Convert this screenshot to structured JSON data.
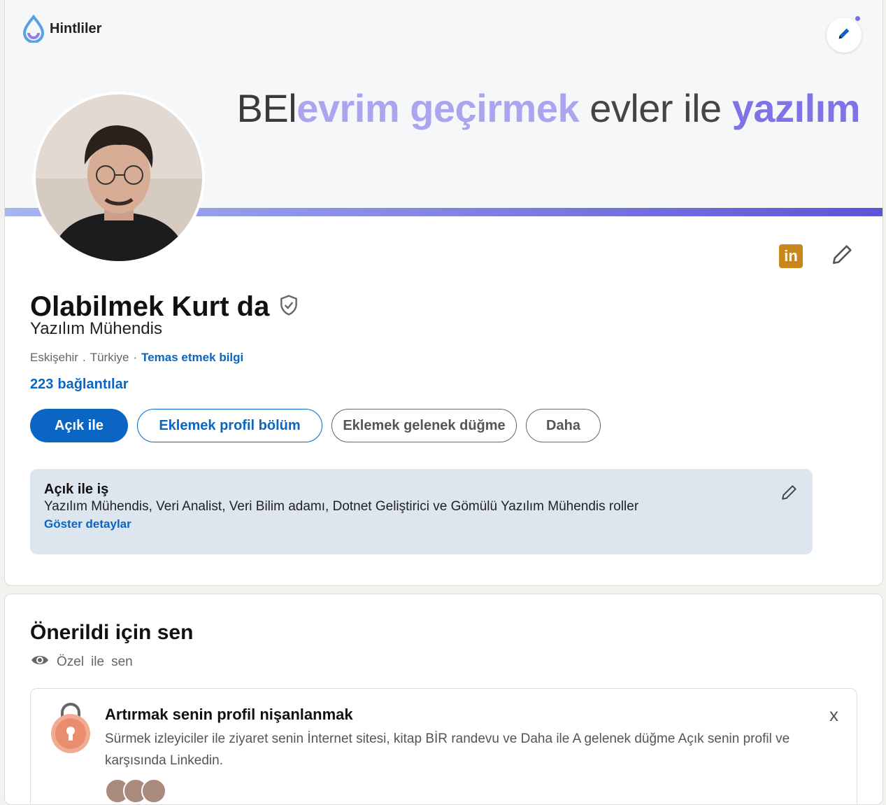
{
  "banner": {
    "brand_name": "Hintliler",
    "tagline": {
      "part1": "BEl",
      "part2": "evrim geçirmek",
      "part3": "evler",
      "part4": "ile",
      "part5": "yazılım"
    }
  },
  "profile": {
    "first_name": "Olabilmek",
    "last_name": "Kurt da",
    "headline": {
      "word1": "Yazılım",
      "word2": "Mühendis"
    },
    "location": {
      "city": "Eskişehir",
      "separator": ".",
      "country": "Türkiye",
      "dot": "·",
      "contact_1": "Temas etmek",
      "contact_2": "bilgi"
    },
    "connections": {
      "count": "223",
      "label": "bağlantılar"
    }
  },
  "actions": {
    "open_to_1": "Açık",
    "open_to_2": "ile",
    "add_section_1": "Eklemek",
    "add_section_2": "profil",
    "add_section_3": "bölüm",
    "custom_button_1": "Eklemek",
    "custom_button_2": "gelenek",
    "custom_button_3": "düğme",
    "more": "Daha"
  },
  "open_to_work": {
    "title_1": "Açık",
    "title_2": "ile",
    "title_3": "iş",
    "roles": [
      "Yazılım",
      "Mühendis",
      ",",
      "Veri",
      "Analist",
      ",",
      "Veri",
      "Bilim adamı",
      ",",
      "Dotnet",
      "Geliştirici",
      "ve",
      "Gömülü",
      "Yazılım",
      "Mühendis",
      "roller"
    ],
    "show_1": "Göster",
    "show_2": "detaylar"
  },
  "suggested": {
    "title_1": "Önerildi",
    "title_2": "için",
    "title_3": "sen",
    "private_1": "Özel",
    "private_2": "ile",
    "private_3": "sen",
    "card": {
      "title_1": "Artırmak",
      "title_2": "senin",
      "title_3": "profil",
      "title_4": "nişanlanmak",
      "desc": [
        "Sürmek",
        "izleyiciler",
        "ile",
        "ziyaret",
        "senin",
        "İnternet sitesi",
        ",",
        "kitap",
        "BİR",
        "randevu",
        "ve",
        "Daha",
        "ile",
        "A",
        "gelenek",
        "düğme",
        "Açık",
        "senin",
        "profil",
        "ve",
        "karşısında",
        "Linkedin",
        "."
      ],
      "close": "x"
    }
  },
  "colors": {
    "linkedin_blue": "#0a66c2",
    "banner_purple": "#7f74e6",
    "banner_light_purple": "#a9a5ee",
    "otw_bg": "#dde5ef",
    "lock_accent": "#e88e6f"
  }
}
